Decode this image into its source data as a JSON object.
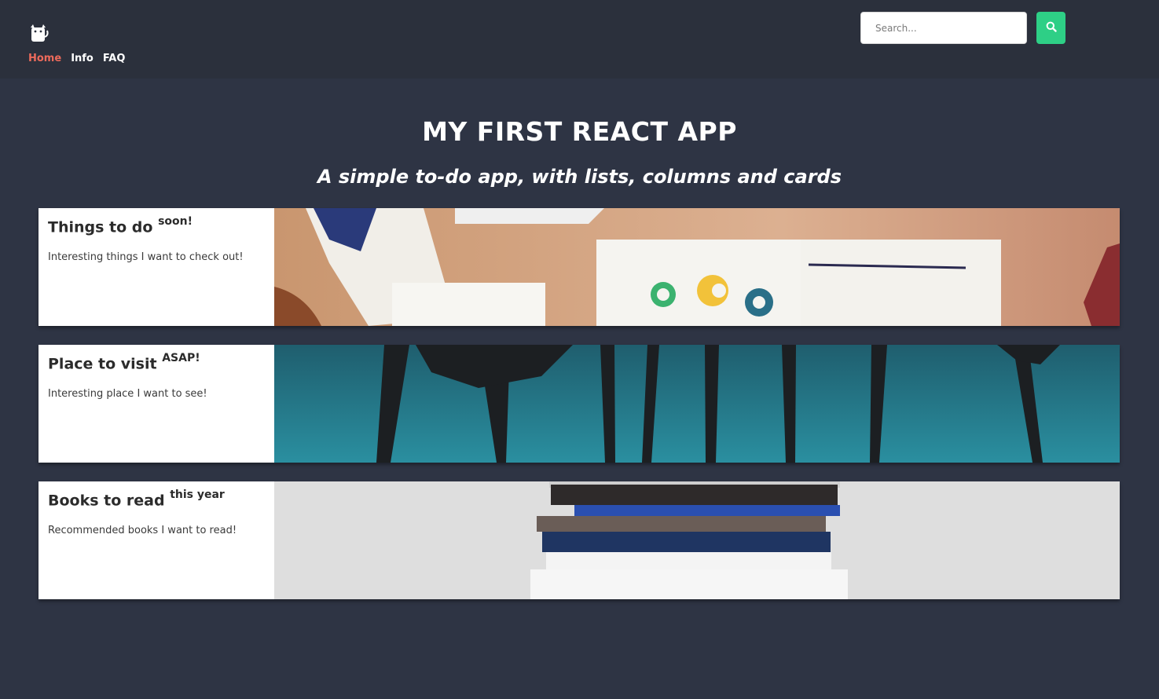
{
  "header": {
    "logo_icon": "cat-icon",
    "nav": [
      {
        "label": "Home",
        "active": true
      },
      {
        "label": "Info",
        "active": false
      },
      {
        "label": "FAQ",
        "active": false
      }
    ],
    "search": {
      "placeholder": "Search...",
      "value": "",
      "button_icon": "search-icon"
    }
  },
  "main": {
    "title": "MY FIRST REACT APP",
    "subtitle": "A simple to-do app, with lists, columns and cards"
  },
  "cards": [
    {
      "title": "Things to do",
      "tag": "soon!",
      "description": "Interesting things I want to check out!",
      "image": "desk-with-books-photo"
    },
    {
      "title": "Place to visit",
      "tag": "ASAP!",
      "description": "Interesting place I want to see!",
      "image": "palm-trees-photo"
    },
    {
      "title": "Books to read",
      "tag": "this year",
      "description": "Recommended books I want to read!",
      "image": "book-stack-photo"
    }
  ],
  "colors": {
    "background": "#2e3444",
    "header": "#2b303c",
    "nav_active": "#ec6a5b",
    "search_button": "#2ecf86"
  }
}
